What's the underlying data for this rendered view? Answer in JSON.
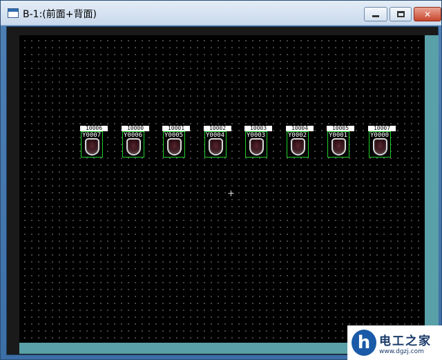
{
  "window": {
    "title": "B-1:(前面+背面)",
    "icons": {
      "app": "app-window-icon",
      "minimize": "minimize-icon",
      "maximize": "maximize-icon",
      "close": "close-icon"
    },
    "close_label": "✕"
  },
  "canvas": {
    "crosshair": "+",
    "lamps": [
      {
        "address": "10006",
        "label": "Y0007"
      },
      {
        "address": "10000",
        "label": "Y0006"
      },
      {
        "address": "10001",
        "label": "Y0005"
      },
      {
        "address": "10002",
        "label": "Y0004"
      },
      {
        "address": "10003",
        "label": "Y0003"
      },
      {
        "address": "10004",
        "label": "Y0002"
      },
      {
        "address": "10005",
        "label": "Y0001"
      },
      {
        "address": "10007",
        "label": "Y0000"
      }
    ]
  },
  "watermark": {
    "name": "电工之家",
    "url": "www.dgzj.com"
  },
  "colors": {
    "lamp_border": "#1fcf2a",
    "canvas_bg": "#000000",
    "frame_accent": "#5aa0a8"
  }
}
